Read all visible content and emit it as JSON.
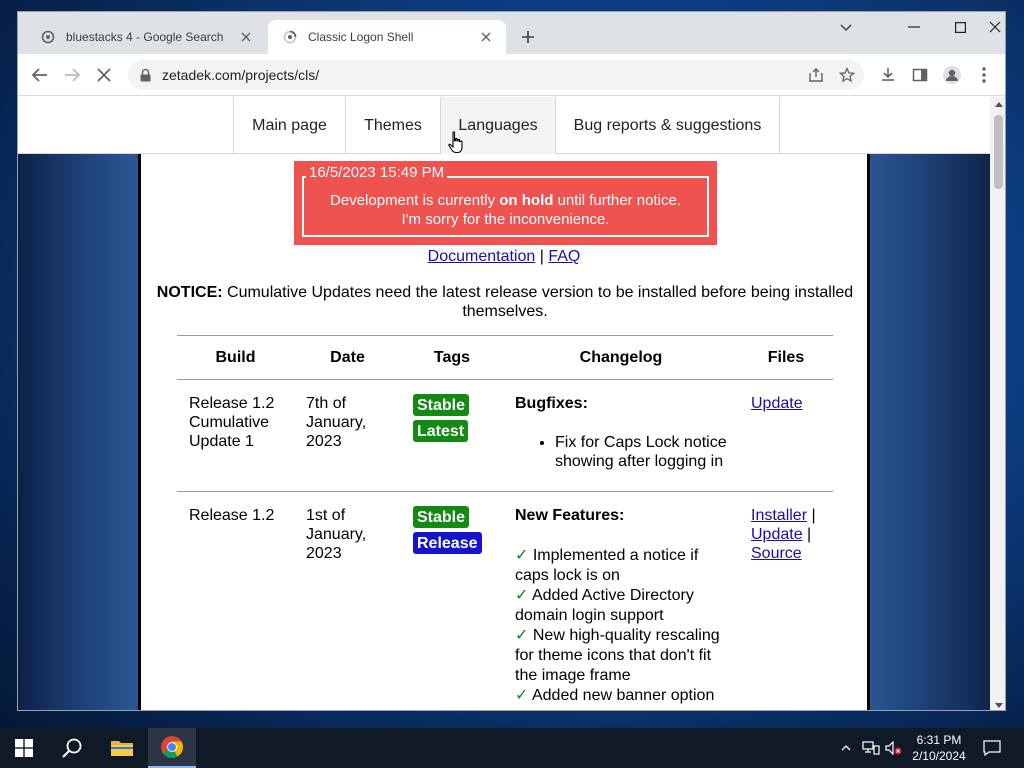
{
  "browser": {
    "tabs": [
      {
        "title": "bluestacks 4 - Google Search",
        "active": false
      },
      {
        "title": "Classic Logon Shell",
        "active": true
      }
    ],
    "url": "zetadek.com/projects/cls/"
  },
  "site": {
    "nav": [
      "Main page",
      "Themes",
      "Languages",
      "Bug reports & suggestions"
    ],
    "banner": {
      "date": "16/5/2023 15:49 PM",
      "line1_before": "Development is currently ",
      "line1_bold": "on hold",
      "line1_after": " until further notice.",
      "line2": "I'm sorry for the inconvenience."
    },
    "doc_links": {
      "documentation": "Documentation",
      "separator": "|",
      "faq": "FAQ"
    },
    "notice": {
      "label": "NOTICE:",
      "text": " Cumulative Updates need the latest release version to be installed before being installed themselves."
    },
    "table": {
      "headers": [
        "Build",
        "Date",
        "Tags",
        "Changelog",
        "Files"
      ],
      "rows": [
        {
          "build": "Release 1.2 Cumulative Update 1",
          "date": "7th of January, 2023",
          "tags": [
            {
              "label": "Stable",
              "color": "#138a13"
            },
            {
              "label": "Latest",
              "color": "#138a13"
            }
          ],
          "changelog_heading": "Bugfixes:",
          "changelog_items": [
            "Fix for Caps Lock notice showing after logging in"
          ],
          "files": [
            "Update"
          ]
        },
        {
          "build": "Release 1.2",
          "date": "1st of January, 2023",
          "tags": [
            {
              "label": "Stable",
              "color": "#138a13"
            },
            {
              "label": "Release",
              "color": "#1414cc"
            }
          ],
          "changelog_heading": "New Features:",
          "changelog_items": [
            "Implemented a notice if caps lock is on",
            "Added Active Directory domain login support",
            "New high-quality rescaling for theme icons that don't fit the image frame",
            "Added new banner option"
          ],
          "files": [
            "Installer",
            "Update",
            "Source"
          ],
          "files_separator": "|"
        }
      ]
    }
  },
  "taskbar": {
    "time": "6:31 PM",
    "date": "2/10/2024"
  },
  "colors": {
    "banner": "#ef5350",
    "stable": "#138a13",
    "release": "#1414cc",
    "link": "#1a0dab"
  }
}
